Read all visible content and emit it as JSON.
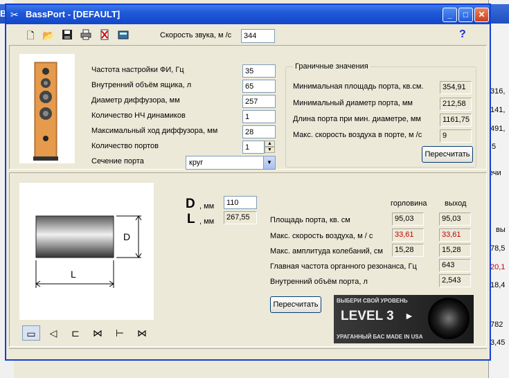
{
  "background": {
    "left_title": "Ba",
    "right_values": [
      "316,",
      "141,",
      "491,",
      "5",
      "ечи",
      "вы",
      "78,5",
      "20,1",
      "18,4",
      "782",
      "3,45"
    ]
  },
  "window": {
    "title": "BassPort - [DEFAULT]",
    "minimize": "_",
    "maximize": "□",
    "close": "✕"
  },
  "toolbar": {
    "icons": [
      "new-file-icon",
      "open-folder-icon",
      "save-icon",
      "print-icon",
      "delete-icon",
      "calculator-icon"
    ],
    "sound_speed_label": "Скорость звука, м /с",
    "sound_speed_value": "344",
    "help_label": "?"
  },
  "params": {
    "tuning_freq_label": "Частота настройки ФИ, Гц",
    "tuning_freq_value": "35",
    "box_volume_label": "Внутренний объём ящика, л",
    "box_volume_value": "65",
    "cone_diameter_label": "Диаметр диффузора, мм",
    "cone_diameter_value": "257",
    "woofer_count_label": "Количество НЧ динамиков",
    "woofer_count_value": "1",
    "max_excursion_label": "Максимальный ход диффузора, мм",
    "max_excursion_value": "28",
    "port_count_label": "Количество портов",
    "port_count_value": "1",
    "port_section_label": "Сечение порта",
    "port_section_value": "круг"
  },
  "limits": {
    "title": "Граничные значения",
    "min_area_label": "Минимальная площадь порта, кв.см.",
    "min_area_value": "354,91",
    "min_diameter_label": "Минимальный диаметр порта, мм",
    "min_diameter_value": "212,58",
    "port_length_label": "Длина порта при мин. диаметре, мм",
    "port_length_value": "1161,75",
    "max_air_speed_label": "Макс. скорость воздуха в порте, м /с",
    "max_air_speed_value": "9",
    "recalc_button": "Пересчитать"
  },
  "port": {
    "d_letter": "D",
    "d_unit": ", мм",
    "d_value": "110",
    "l_letter": "L",
    "l_unit": ", мм",
    "l_value": "267,55",
    "diagram_d": "D",
    "diagram_l": "L"
  },
  "results": {
    "col_throat": "горловина",
    "col_exit": "выход",
    "rows": [
      {
        "label": "Площадь порта, кв. см",
        "throat": "95,03",
        "exit": "95,03"
      },
      {
        "label": "Макс. скорость воздуха, м / с",
        "throat": "33,61",
        "exit": "33,61"
      },
      {
        "label": "Макс. амплитуда колебаний, см",
        "throat": "15,28",
        "exit": "15,28"
      },
      {
        "label": "Главная частота органного резонанса, Гц",
        "throat": "",
        "exit": "643"
      },
      {
        "label": "Внутренний объём порта, л",
        "throat": "",
        "exit": "2,543"
      }
    ],
    "recalc_button": "Пересчитать"
  },
  "ad": {
    "top_text": "ВЫБЕРИ СВОЙ УРОВЕНЬ",
    "main_text": "LEVEL 3",
    "bottom_text": "УРАГАННЫЙ БАС MADE IN USA"
  },
  "colors": {
    "warning": "#c00000",
    "title_bar": "#1f59d8"
  }
}
